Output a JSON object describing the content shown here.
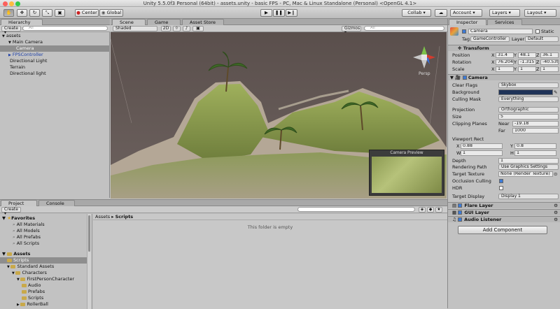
{
  "window_title": "Unity 5.5.0f3 Personal (64bit) - assets.unity - basic FPS - PC, Mac & Linux Standalone (Personal) <OpenGL 4.1>",
  "toolbar": {
    "center": "Center",
    "global": "Global",
    "collab": "Collab ▾",
    "account": "Account",
    "layers": "Layers",
    "layout": "Layout"
  },
  "hierarchy": {
    "tab": "Hierarchy",
    "create": "Create ▾",
    "search": "All",
    "items": [
      {
        "label": "assets",
        "indent": 0,
        "arrow": "▼"
      },
      {
        "label": "Main Camera",
        "indent": 1,
        "arrow": "▼"
      },
      {
        "label": "Camera",
        "indent": 2,
        "arrow": ""
      },
      {
        "label": "FPSController",
        "indent": 1,
        "arrow": "▶"
      },
      {
        "label": "Directional Light",
        "indent": 1,
        "arrow": ""
      },
      {
        "label": "Terrain",
        "indent": 1,
        "arrow": ""
      },
      {
        "label": "Directional light",
        "indent": 1,
        "arrow": ""
      }
    ]
  },
  "scene": {
    "tabs": [
      "Scene",
      "Game",
      "Asset Store"
    ],
    "shaded": "Shaded",
    "mode2d": "2D",
    "gizmos": "Gizmos ▾",
    "search": "All",
    "persp": "Persp",
    "camera_preview": "Camera Preview"
  },
  "project": {
    "tabs": [
      "Project",
      "Console"
    ],
    "create": "Create ▾",
    "favorites_label": "Favorites",
    "favorites": [
      "All Materials",
      "All Models",
      "All Prefabs",
      "All Scripts"
    ],
    "assets_label": "Assets",
    "tree": [
      {
        "label": "Scripts",
        "indent": 1
      },
      {
        "label": "Standard Assets",
        "indent": 1
      },
      {
        "label": "Characters",
        "indent": 2
      },
      {
        "label": "FirstPersonCharacter",
        "indent": 3
      },
      {
        "label": "Audio",
        "indent": 4
      },
      {
        "label": "Prefabs",
        "indent": 4
      },
      {
        "label": "Scripts",
        "indent": 4
      },
      {
        "label": "RollerBall",
        "indent": 3
      }
    ],
    "breadcrumb_root": "Assets",
    "breadcrumb_sep": "▸",
    "breadcrumb_current": "Scripts",
    "empty_msg": "This folder is empty"
  },
  "inspector": {
    "tabs": [
      "Inspector",
      "Services"
    ],
    "object_name": "Camera",
    "static_label": "Static",
    "tag_label": "Tag",
    "tag_value": "GameController",
    "layer_label": "Layer",
    "layer_value": "Default",
    "transform": {
      "title": "Transform",
      "position_label": "Position",
      "rotation_label": "Rotation",
      "scale_label": "Scale",
      "axes": [
        "X",
        "Y",
        "Z"
      ],
      "position": [
        "31.4",
        "48.1",
        "36.1"
      ],
      "rotation": [
        "76.204",
        "-1.315",
        "-40.539"
      ],
      "scale": [
        "1",
        "1",
        "1"
      ]
    },
    "camera": {
      "title": "Camera",
      "clear_flags_label": "Clear Flags",
      "clear_flags": "Skybox",
      "background_label": "Background",
      "background_color": "#1f3358",
      "culling_label": "Culling Mask",
      "culling": "Everything",
      "projection_label": "Projection",
      "projection": "Orthographic",
      "size_label": "Size",
      "size": "5",
      "clipping_label": "Clipping Planes",
      "near_label": "Near",
      "near": "-19.18",
      "far_label": "Far",
      "far": "1000",
      "viewport_label": "Viewport Rect",
      "vx_label": "X",
      "vx": "0.88",
      "vy_label": "Y",
      "vy": "0.8",
      "vw_label": "W",
      "vw": "1",
      "vh_label": "H",
      "vh": "1",
      "depth_label": "Depth",
      "depth": "1",
      "rendering_label": "Rendering Path",
      "rendering": "Use Graphics Settings",
      "target_label": "Target Texture",
      "target": "None (Render Texture)",
      "occlusion_label": "Occlusion Culling",
      "hdr_label": "HDR",
      "display_label": "Target Display",
      "display": "Display 1"
    },
    "components": [
      "Flare Layer",
      "GUI Layer",
      "Audio Listener"
    ],
    "add_component": "Add Component"
  }
}
